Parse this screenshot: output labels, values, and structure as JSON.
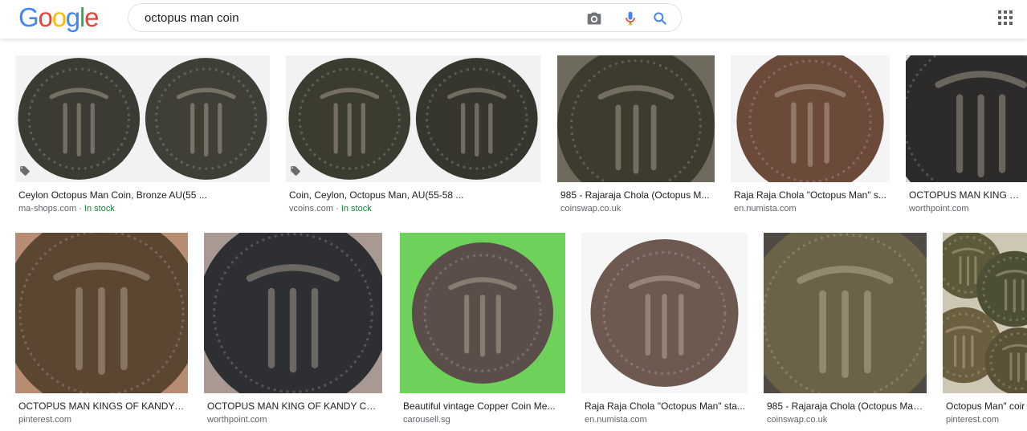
{
  "logo": {
    "letters": [
      {
        "ch": "G",
        "color": "#4285F4"
      },
      {
        "ch": "o",
        "color": "#EA4335"
      },
      {
        "ch": "o",
        "color": "#FBBC05"
      },
      {
        "ch": "g",
        "color": "#4285F4"
      },
      {
        "ch": "l",
        "color": "#34A853"
      },
      {
        "ch": "e",
        "color": "#EA4335"
      }
    ]
  },
  "search": {
    "query": "octopus man coin"
  },
  "icons": {
    "camera": "camera-icon",
    "mic": "microphone-icon",
    "search": "search-icon",
    "apps": "apps-grid-icon"
  },
  "results": [
    {
      "caption": "Ceylon Octopus Man Coin, Bronze AU(55 ...",
      "source": "ma-shops.com",
      "stock": "In stock"
    },
    {
      "caption": "Coin, Ceylon, Octopus Man, AU(55-58 ...",
      "source": "vcoins.com",
      "stock": "In stock"
    },
    {
      "caption": "985 - Rajaraja Chola (Octopus M...",
      "source": "coinswap.co.uk",
      "stock": ""
    },
    {
      "caption": "Raja Raja Chola \"Octopus Man\" s...",
      "source": "en.numista.com",
      "stock": ""
    },
    {
      "caption": "OCTOPUS MAN KING OF K",
      "source": "worthpoint.com",
      "stock": ""
    },
    {
      "caption": "OCTOPUS MAN KINGS OF KANDY C...",
      "source": "pinterest.com",
      "stock": ""
    },
    {
      "caption": "OCTOPUS MAN KING OF KANDY CEY...",
      "source": "worthpoint.com",
      "stock": ""
    },
    {
      "caption": "Beautiful vintage Copper Coin Me...",
      "source": "carousell.sg",
      "stock": ""
    },
    {
      "caption": "Raja Raja Chola \"Octopus Man\" sta...",
      "source": "en.numista.com",
      "stock": ""
    },
    {
      "caption": "985 - Rajaraja Chola (Octopus Man...",
      "source": "coinswap.co.uk",
      "stock": ""
    },
    {
      "caption": "Octopus Man\" coir",
      "source": "pinterest.com",
      "stock": ""
    }
  ]
}
